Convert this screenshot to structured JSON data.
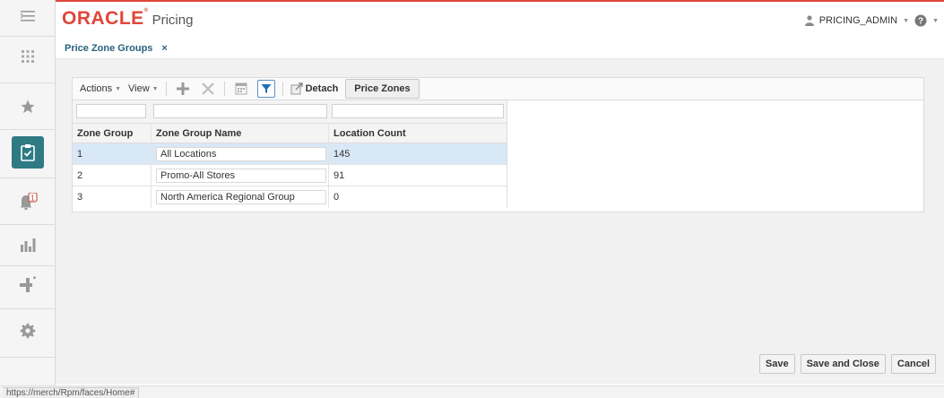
{
  "header": {
    "brand": "ORACLE",
    "product": "Pricing",
    "user": "PRICING_ADMIN"
  },
  "tab": {
    "title": "Price Zone Groups",
    "close": "×"
  },
  "toolbar": {
    "actions": "Actions",
    "view": "View",
    "detach": "Detach",
    "price_zones": "Price Zones"
  },
  "table": {
    "columns": [
      "Zone Group",
      "Zone Group Name",
      "Location Count"
    ],
    "rows": [
      {
        "zone_group": "1",
        "name": "All Locations",
        "count": "145",
        "selected": true
      },
      {
        "zone_group": "2",
        "name": "Promo-All Stores",
        "count": "91",
        "selected": false
      },
      {
        "zone_group": "3",
        "name": "North America Regional Group",
        "count": "0",
        "selected": false
      }
    ]
  },
  "footer": {
    "save": "Save",
    "save_close": "Save and Close",
    "cancel": "Cancel"
  },
  "status": {
    "url": "https://merch/Rpm/faces/Home#"
  },
  "notifications": {
    "count": "1"
  },
  "colors": {
    "brand_red": "#e0463a",
    "active_rail": "#2f7a83",
    "selected_row": "#d9e8f6"
  }
}
